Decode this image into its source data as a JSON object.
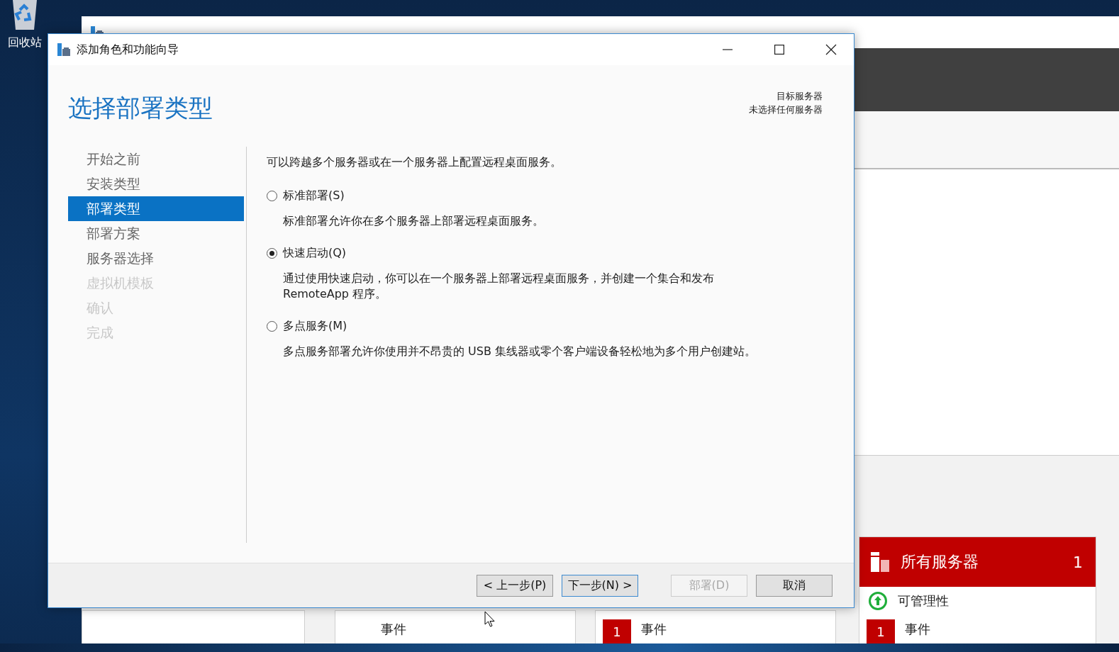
{
  "desktop": {
    "icons": [
      {
        "label": "回收站"
      }
    ]
  },
  "background_window": {
    "tiles": [
      {
        "rows": [
          {
            "kind": "plain",
            "label": "事件"
          }
        ]
      },
      {
        "rows": [
          {
            "kind": "badge",
            "badge": "1",
            "label": "事件"
          }
        ]
      },
      {
        "title": "所有服务器",
        "count": "1",
        "rows": [
          {
            "kind": "status",
            "label": "可管理性"
          },
          {
            "kind": "badge",
            "badge": "1",
            "label": "事件"
          }
        ]
      }
    ]
  },
  "wizard": {
    "title": "添加角色和功能向导",
    "heading": "选择部署类型",
    "target": {
      "label": "目标服务器",
      "value": "未选择任何服务器"
    },
    "nav": [
      {
        "label": "开始之前",
        "selected": false,
        "disabled": false
      },
      {
        "label": "安装类型",
        "selected": false,
        "disabled": false
      },
      {
        "label": "部署类型",
        "selected": true,
        "disabled": false
      },
      {
        "label": "部署方案",
        "selected": false,
        "disabled": false
      },
      {
        "label": "服务器选择",
        "selected": false,
        "disabled": false
      },
      {
        "label": "虚拟机模板",
        "selected": false,
        "disabled": true
      },
      {
        "label": "确认",
        "selected": false,
        "disabled": true
      },
      {
        "label": "完成",
        "selected": false,
        "disabled": true
      }
    ],
    "intro": "可以跨越多个服务器或在一个服务器上配置远程桌面服务。",
    "options": [
      {
        "label": "标准部署(S)",
        "description": "标准部署允许你在多个服务器上部署远程桌面服务。",
        "selected": false
      },
      {
        "label": "快速启动(Q)",
        "description": "通过使用快速启动，你可以在一个服务器上部署远程桌面服务，并创建一个集合和发布 RemoteApp 程序。",
        "selected": true
      },
      {
        "label": "多点服务(M)",
        "description": "多点服务部署允许你使用并不昂贵的 USB 集线器或零个客户端设备轻松地为多个用户创建站。",
        "selected": false
      }
    ],
    "buttons": [
      {
        "label": "< 上一步(P)",
        "disabled": false,
        "default": false
      },
      {
        "label": "下一步(N) >",
        "disabled": false,
        "default": true
      },
      {
        "label": "部署(D)",
        "disabled": true,
        "default": false
      },
      {
        "label": "取消",
        "disabled": false,
        "default": false
      }
    ]
  }
}
